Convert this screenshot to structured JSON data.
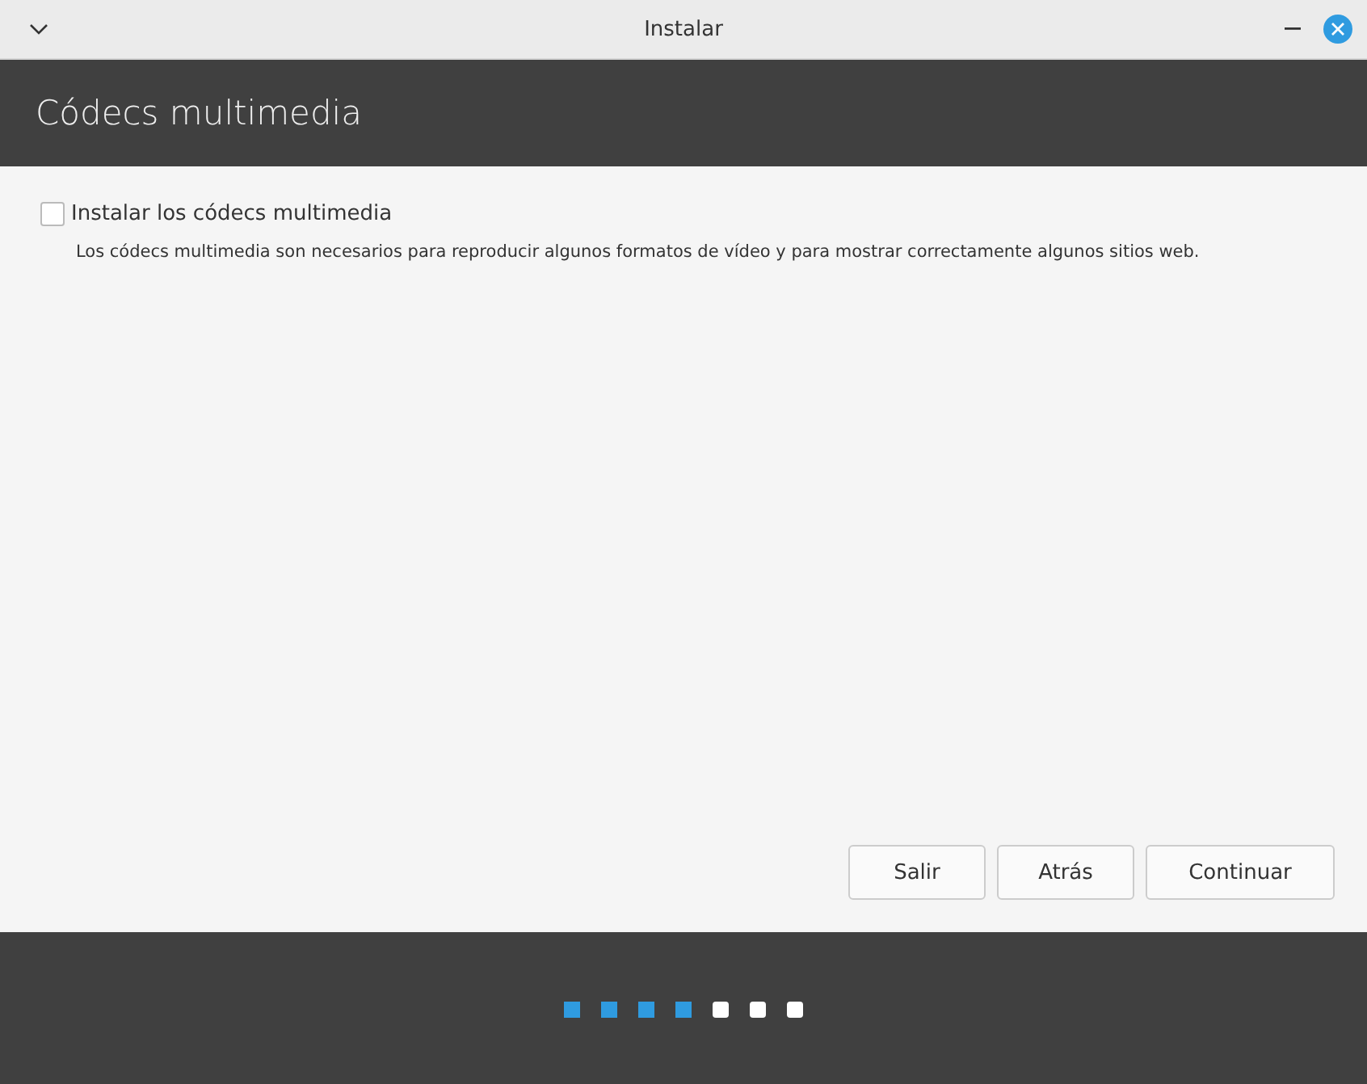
{
  "window": {
    "title": "Instalar"
  },
  "header": {
    "title": "Códecs multimedia"
  },
  "option": {
    "label": "Instalar los códecs multimedia",
    "checked": false,
    "description": "Los códecs multimedia son necesarios para reproducir algunos formatos de vídeo y para mostrar correctamente algunos sitios web."
  },
  "buttons": [
    "Salir",
    "Atrás",
    "Continuar"
  ],
  "steps": [
    {
      "done": true
    },
    {
      "done": true
    },
    {
      "done": true
    },
    {
      "done": true
    },
    {
      "done": false
    },
    {
      "done": false
    },
    {
      "done": false
    }
  ]
}
